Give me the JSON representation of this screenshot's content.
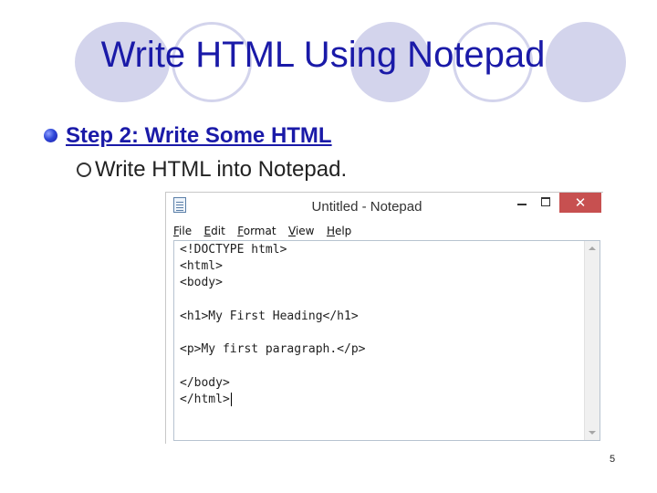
{
  "slide": {
    "title": "Write HTML Using Notepad",
    "bullet_1": "Step 2: Write Some HTML",
    "bullet_2": "Write HTML into Notepad.",
    "page_number": "5"
  },
  "colors": {
    "title": "#1a1aa8",
    "decor_circles": "#d3d4ec",
    "close_button": "#c75050"
  },
  "notepad": {
    "title": "Untitled - Notepad",
    "icon": "notepad-app-icon",
    "close_glyph": "✕",
    "menu": [
      {
        "key": "F",
        "rest": "ile"
      },
      {
        "key": "E",
        "rest": "dit"
      },
      {
        "key": "F",
        "rest": "ormat"
      },
      {
        "key": "V",
        "rest": "iew"
      },
      {
        "key": "H",
        "rest": "elp"
      }
    ],
    "lines": [
      "<!DOCTYPE html>",
      "<html>",
      "<body>",
      "",
      "<h1>My First Heading</h1>",
      "",
      "<p>My first paragraph.</p>",
      "",
      "</body>",
      "</html>"
    ]
  }
}
